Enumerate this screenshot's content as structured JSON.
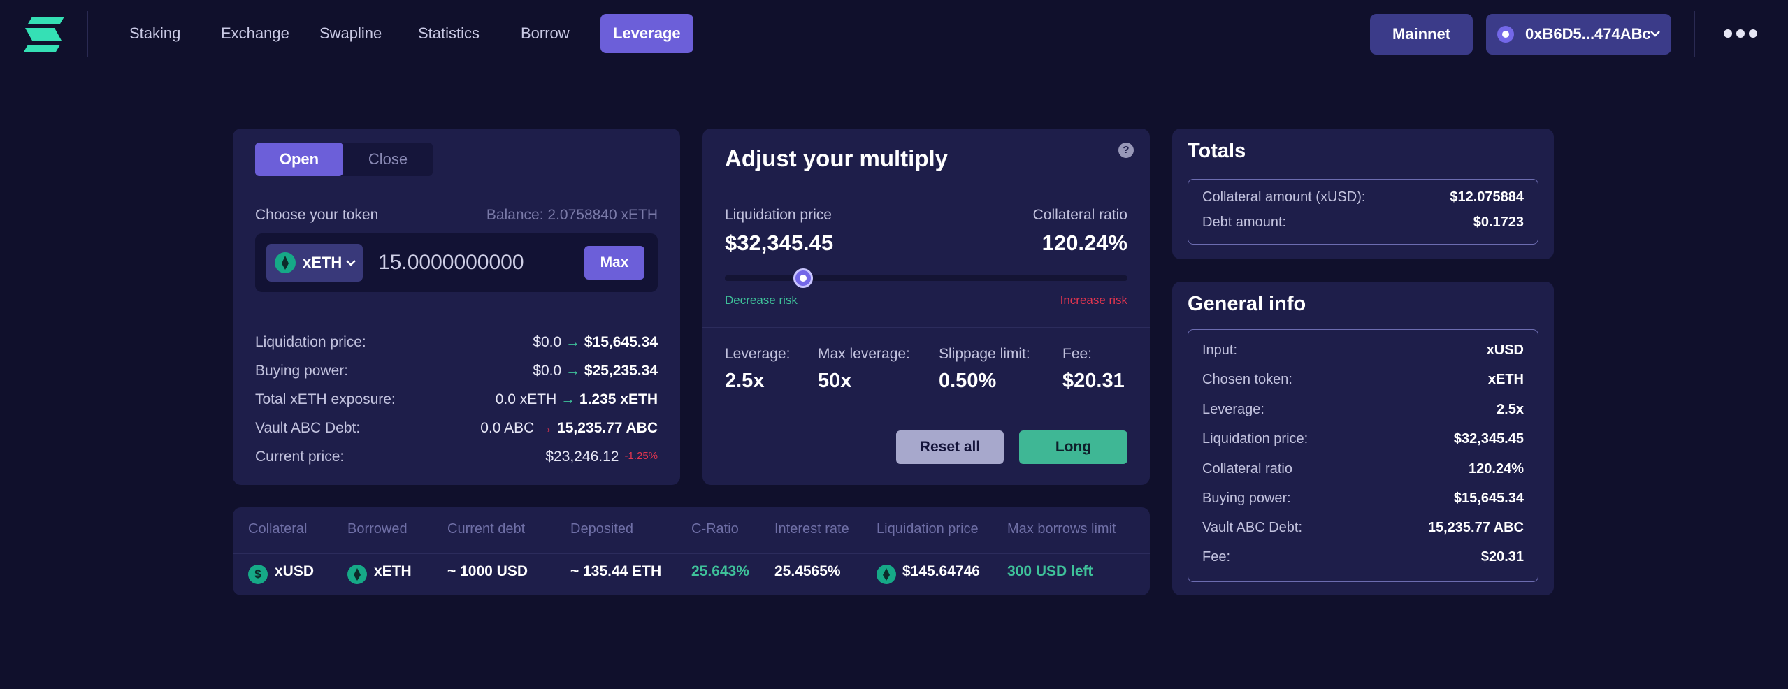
{
  "nav": {
    "links": [
      "Staking",
      "Exchange",
      "Swapline",
      "Statistics",
      "Borrow",
      "Leverage"
    ],
    "active": "Leverage",
    "network_label": "Mainnet",
    "wallet_label": "0xB6D5...474ABc",
    "more_icon": "more-dots-icon",
    "logo_icon": "logo-icon"
  },
  "colors": {
    "background": "#10102c",
    "card": "#1e1e4a",
    "accent": "#6c5fd9",
    "success": "#3fc29a",
    "danger": "#e2354f"
  },
  "trade": {
    "tabs": [
      "Open",
      "Close"
    ],
    "active_tab": "Open",
    "choose_token_label": "Choose your token",
    "balance_text": "Balance: 2.0758840 xETH",
    "token": "xETH",
    "amount": "15.0000000000",
    "max_label": "Max",
    "details": [
      {
        "label": "Liquidation price:",
        "from": "$0.0",
        "to": "$15,645.34",
        "arrow": "green"
      },
      {
        "label": "Buying power:",
        "from": "$0.0",
        "to": "$25,235.34",
        "arrow": "green"
      },
      {
        "label": "Total xETH exposure:",
        "from": "0.0 xETH",
        "to": "1.235 xETH",
        "arrow": "green"
      },
      {
        "label": "Vault ABC Debt:",
        "from": "0.0 ABC",
        "to": "15,235.77 ABC",
        "arrow": "red"
      }
    ],
    "arrow_symbol": "→",
    "current_price_label": "Current price:",
    "current_price": "$23,246.12",
    "current_price_change": "-1.25%"
  },
  "multiply": {
    "title": "Adjust your multiply",
    "help_icon": "question-icon",
    "liquidation_label": "Liquidation price",
    "liquidation_value": "$32,345.45",
    "collateral_label": "Collateral ratio",
    "collateral_value": "120.24%",
    "slider_level": 0.195,
    "decrease_label": "Decrease risk",
    "increase_label": "Increase risk",
    "stats": [
      {
        "label": "Leverage:",
        "value": "2.5x"
      },
      {
        "label": "Max leverage:",
        "value": "50x"
      },
      {
        "label": "Slippage limit:",
        "value": "0.50%"
      },
      {
        "label": "Fee:",
        "value": "$20.31"
      }
    ],
    "reset_label": "Reset all",
    "long_label": "Long"
  },
  "positions": {
    "headers": [
      "Collateral",
      "Borrowed",
      "Current debt",
      "Deposited",
      "C-Ratio",
      "Interest rate",
      "Liquidation price",
      "Max borrows limit"
    ],
    "row": {
      "collateral": "xUSD",
      "borrowed": "xETH",
      "current_debt": "~ 1000 USD",
      "deposited": "~ 135.44 ETH",
      "c_ratio": "25.643%",
      "interest_rate": "25.4565%",
      "liquidation_price": "$145.64746",
      "max_borrows": "300 USD left"
    },
    "usd_glyph": "$"
  },
  "totals": {
    "title": "Totals",
    "rows": [
      {
        "label": "Collateral amount (xUSD):",
        "value": "$12.075884"
      },
      {
        "label": "Debt amount:",
        "value": "$0.1723"
      }
    ]
  },
  "general": {
    "title": "General info",
    "rows": [
      {
        "label": "Input:",
        "value": "xUSD"
      },
      {
        "label": "Chosen token:",
        "value": "xETH"
      },
      {
        "label": "Leverage:",
        "value": "2.5x"
      },
      {
        "label": "Liquidation price:",
        "value": "$32,345.45"
      },
      {
        "label": "Collateral ratio",
        "value": "120.24%"
      },
      {
        "label": "Buying power:",
        "value": "$15,645.34"
      },
      {
        "label": "Vault ABC Debt:",
        "value": "15,235.77 ABC"
      },
      {
        "label": "Fee:",
        "value": "$20.31"
      }
    ]
  }
}
